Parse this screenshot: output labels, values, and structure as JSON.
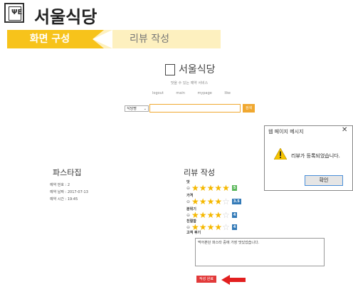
{
  "header": {
    "title": "서울식당",
    "logo_glyph": "ΨΕ"
  },
  "steps": {
    "step1": "화면 구성",
    "step2": "리뷰 작성",
    "active_color": "#f7c31b",
    "inactive_color": "#fdf0bf"
  },
  "site": {
    "name": "서울식당",
    "tagline": "맛을 수 있는 예약 서비스",
    "nav": [
      "logout",
      "main",
      "mypage",
      "like"
    ],
    "select_value": "식당명",
    "search_button": "검색",
    "accent": "#f0a830"
  },
  "restaurant": {
    "name": "파스타집",
    "reservation_no": "예약 번호 : 2",
    "reservation_date": "예약 날짜 : 2017-07-13",
    "reservation_time": "예약 시간 : 19:45"
  },
  "review": {
    "title": "리뷰 작성",
    "categories": [
      {
        "label": "맛",
        "stars": 5,
        "score": "5",
        "badge_color": "#5cb85c"
      },
      {
        "label": "가격",
        "stars": 3.5,
        "score": "3.5",
        "badge_color": "#337ab7"
      },
      {
        "label": "분위기",
        "stars": 4,
        "score": "4",
        "badge_color": "#337ab7"
      },
      {
        "label": "친절함",
        "stars": 4,
        "score": "4",
        "badge_color": "#337ab7"
      }
    ],
    "comment_label": "고객 후기",
    "comment_text": "먹어본던 파스타 중에 가장 맛있었습니다.",
    "submit_label": "작성 완료"
  },
  "dialog": {
    "title": "웹 페이지 메시지",
    "message": "리뷰가 등록되었습니다.",
    "ok_label": "확인",
    "close": "✕"
  }
}
